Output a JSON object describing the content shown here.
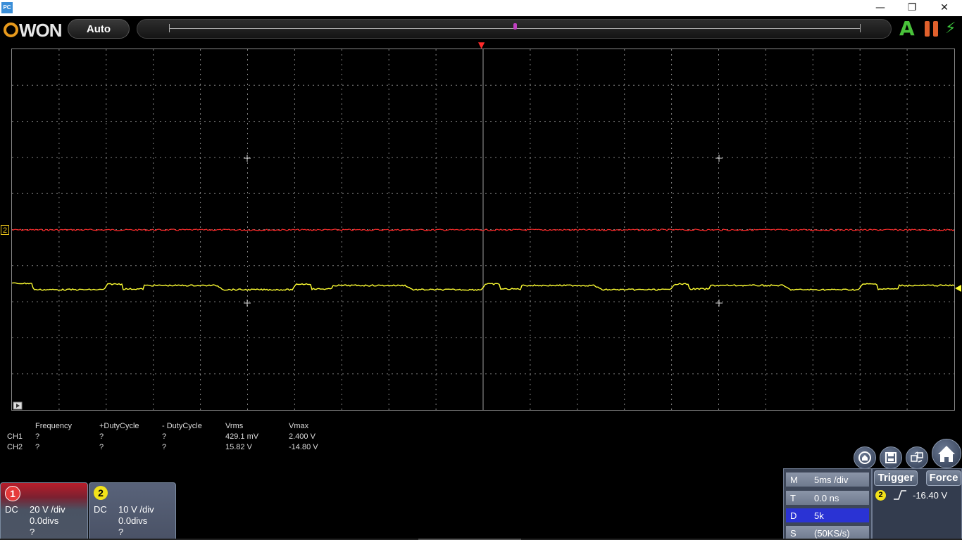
{
  "window": {
    "app_icon_text": "PC",
    "minimize_glyph": "—",
    "restore_glyph": "❐",
    "close_glyph": "✕"
  },
  "toolbar": {
    "logo_text": "WON",
    "auto_label": "Auto",
    "auto_icon": "A",
    "bolt_icon": "⚡"
  },
  "screen": {
    "ch2_marker_label": "2",
    "trigger_marker": "▼",
    "colors": {
      "ch1": "#ffff33",
      "ch2": "#ff2a2a",
      "grid": "#b0b0b0",
      "trigger": "#ff2a2a"
    }
  },
  "measurements": {
    "headers": [
      "Frequency",
      "+DutyCycle",
      "- DutyCycle",
      "Vrms",
      "Vmax"
    ],
    "rows": [
      {
        "label": "CH1",
        "values": [
          "?",
          "?",
          "?",
          "429.1 mV",
          "2.400 V"
        ]
      },
      {
        "label": "CH2",
        "values": [
          "?",
          "?",
          "?",
          "15.82 V",
          "-14.80 V"
        ]
      }
    ]
  },
  "channels": {
    "ch1": {
      "badge": "1",
      "coupling": "DC",
      "scale": "20 V /div",
      "offset": "0.0divs",
      "probe": "?"
    },
    "ch2": {
      "badge": "2",
      "coupling": "DC",
      "scale": "10 V /div",
      "offset": "0.0divs",
      "probe": "?"
    }
  },
  "horizontal": {
    "rows": [
      {
        "key": "M",
        "value": "5ms /div"
      },
      {
        "key": "T",
        "value": "0.0 ns"
      },
      {
        "key": "D",
        "value": "5k"
      },
      {
        "key": "S",
        "value": "(50KS/s)"
      }
    ]
  },
  "trigger": {
    "trigger_label": "Trigger",
    "force_label": "Force",
    "source_badge": "2",
    "level": "-16.40 V"
  },
  "icons": {
    "home": "home-icon",
    "save": "save-icon",
    "swap": "swap-icon",
    "undo_home": "reset-icon"
  }
}
